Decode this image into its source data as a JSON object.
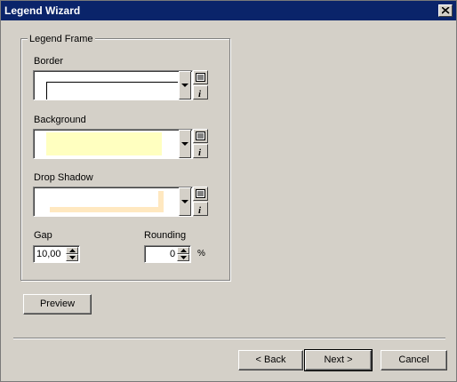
{
  "window": {
    "title": "Legend Wizard"
  },
  "legend_frame": {
    "group_label": "Legend Frame",
    "border": {
      "label": "Border",
      "preview_color": "#ffffff",
      "line_color": "#000000"
    },
    "background": {
      "label": "Background",
      "preview_color": "#ffffc0"
    },
    "drop_shadow": {
      "label": "Drop Shadow",
      "preview_color": "#ffe8c0"
    },
    "gap": {
      "label": "Gap",
      "value": "10,00"
    },
    "rounding": {
      "label": "Rounding",
      "value": "0",
      "unit": "%"
    }
  },
  "buttons": {
    "preview": "Preview",
    "back": "< Back",
    "next": "Next >",
    "cancel": "Cancel"
  },
  "colors": {
    "titlebar": "#0a246a",
    "face": "#d4d0c8"
  }
}
